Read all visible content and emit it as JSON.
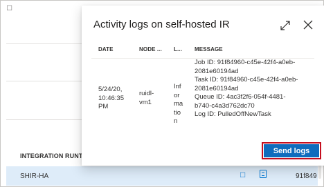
{
  "background": {
    "table_header": "INTEGRATION RUNTIME",
    "row": {
      "name": "SHIR-HA",
      "id_fragment": "91f849",
      "chat_icon": "chat-icon",
      "doc_icon": "document-icon"
    }
  },
  "modal": {
    "title": "Activity logs on self-hosted IR",
    "expand_icon": "expand-icon",
    "close_icon": "close-icon",
    "columns": {
      "date": "DATE",
      "node": "NODE ...",
      "level": "L...",
      "message": "MESSAGE"
    },
    "row": {
      "date": [
        "5/24/20,",
        "10:46:35",
        "PM"
      ],
      "node": [
        "ruidl-",
        "vm1"
      ],
      "level": [
        "Inf",
        "or",
        "ma",
        "tio",
        "n"
      ],
      "message": [
        "Job ID: 91f84960-c45e-42f4-a0eb-",
        "2081e60194ad",
        "Task ID: 91f84960-c45e-42f4-a0eb-",
        "2081e60194ad",
        "Queue ID: 4ac3f2f6-054f-4481-",
        "b740-c4a3d762dc70",
        "Log ID: PulledOffNewTask"
      ]
    },
    "send_button_label": "Send logs"
  },
  "colors": {
    "primary_button": "#0f6cbd",
    "highlight_outline": "#c50f1f",
    "selected_row": "#deecf9"
  }
}
